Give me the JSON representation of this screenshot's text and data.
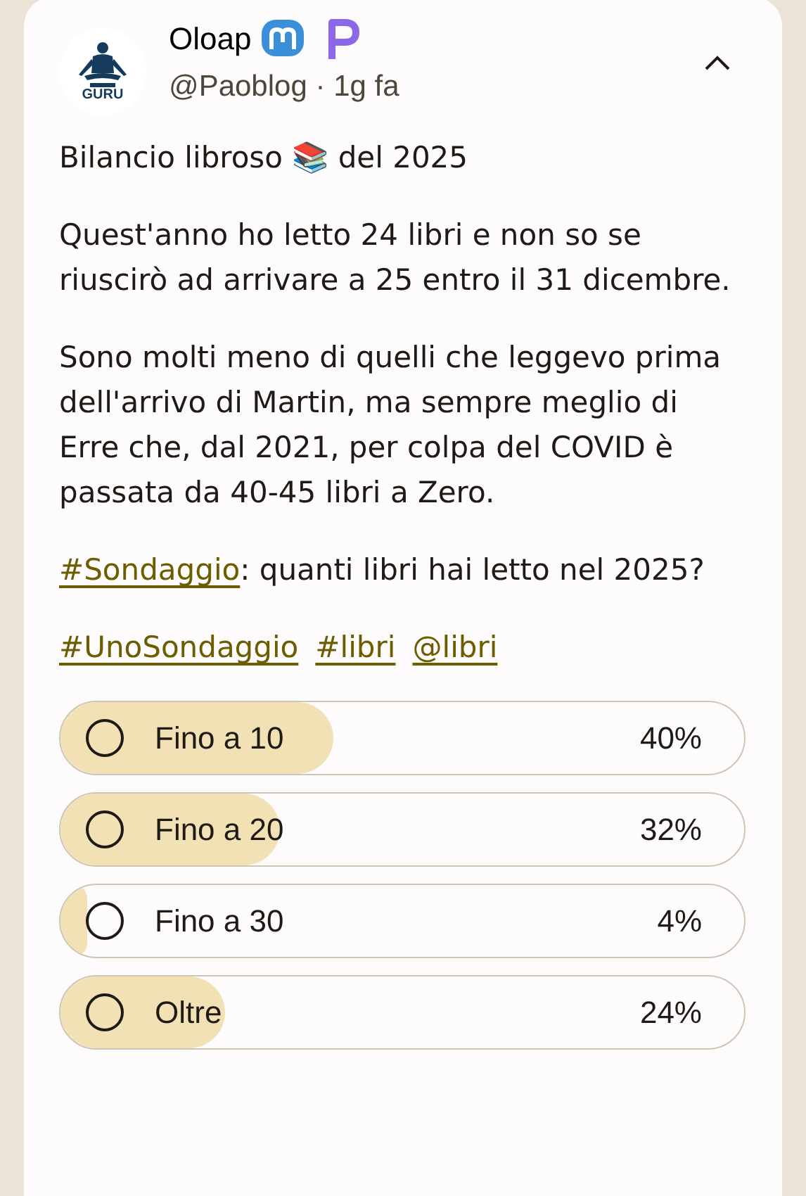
{
  "post": {
    "author": "Oloap",
    "handle": "@Paoblog",
    "separator": "·",
    "time": "1g fa",
    "avatar_text": "GURU",
    "paragraphs": [
      [
        {
          "kind": "text",
          "text": "Bilancio libroso 📚 del 2025"
        }
      ],
      [
        {
          "kind": "text",
          "text": "Quest'anno ho letto 24 libri e non so se riuscirò ad arrivare a 25 entro il 31 dicembre."
        }
      ],
      [
        {
          "kind": "text",
          "text": "Sono molti meno di quelli che leggevo prima dell'arrivo di Martin, ma sempre meglio di Erre che, dal 2021, per colpa del COVID è passata da 40-45 libri a Zero."
        }
      ],
      [
        {
          "kind": "link",
          "text": "#Sondaggio"
        },
        {
          "kind": "text",
          "text": ": quanti libri hai letto nel 2025?"
        }
      ],
      [
        {
          "kind": "link",
          "text": "#UnoSondaggio"
        },
        {
          "kind": "link",
          "text": "#libri"
        },
        {
          "kind": "link",
          "text": "@libri"
        }
      ]
    ],
    "poll": [
      {
        "label": "Fino a 10",
        "percent": "40%",
        "level": 0.4,
        "selected": false
      },
      {
        "label": "Fino a 20",
        "percent": "32%",
        "level": 0.32,
        "selected": false
      },
      {
        "label": "Fino a 30",
        "percent": "4%",
        "level": 0.04,
        "selected": false
      },
      {
        "label": "Oltre",
        "percent": "24%",
        "level": 0.24,
        "selected": false
      }
    ]
  }
}
